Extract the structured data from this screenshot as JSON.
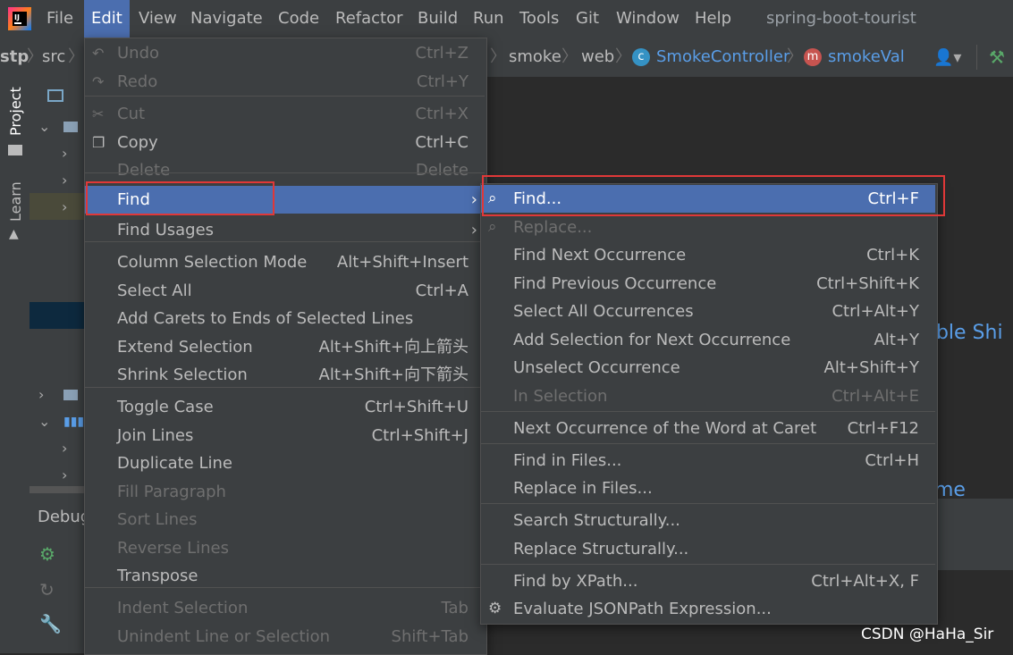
{
  "menubar": {
    "items": [
      "File",
      "Edit",
      "View",
      "Navigate",
      "Code",
      "Refactor",
      "Build",
      "Run",
      "Tools",
      "Git",
      "Window",
      "Help"
    ],
    "active": "Edit",
    "project_name": "spring-boot-tourist"
  },
  "navbar": {
    "crumbs": [
      "stp",
      "src",
      "smoke",
      "web",
      "SmokeController",
      "smokeVal"
    ],
    "class_badge": "c",
    "method_badge": "m"
  },
  "sidebar": {
    "project_tab": "Project",
    "learn_tab": "Learn",
    "debug_label": "Debug"
  },
  "edit_menu": {
    "items": [
      {
        "label": "Undo",
        "shortcut": "Ctrl+Z",
        "disabled": true
      },
      {
        "label": "Redo",
        "shortcut": "Ctrl+Y",
        "disabled": true
      },
      {
        "label": "Cut",
        "shortcut": "Ctrl+X",
        "disabled": true
      },
      {
        "label": "Copy",
        "shortcut": "Ctrl+C",
        "disabled": false
      },
      {
        "label": "Delete",
        "shortcut": "Delete",
        "disabled": true
      },
      {
        "label": "Find",
        "shortcut": "",
        "disabled": false,
        "submenu": true,
        "selected": true
      },
      {
        "label": "Find Usages",
        "shortcut": "",
        "disabled": false,
        "submenu": true
      },
      {
        "label": "Column Selection Mode",
        "shortcut": "Alt+Shift+Insert",
        "disabled": false
      },
      {
        "label": "Select All",
        "shortcut": "Ctrl+A",
        "disabled": false
      },
      {
        "label": "Add Carets to Ends of Selected Lines",
        "shortcut": "",
        "disabled": false
      },
      {
        "label": "Extend Selection",
        "shortcut": "Alt+Shift+向上箭头",
        "disabled": false
      },
      {
        "label": "Shrink Selection",
        "shortcut": "Alt+Shift+向下箭头",
        "disabled": false
      },
      {
        "label": "Toggle Case",
        "shortcut": "Ctrl+Shift+U",
        "disabled": false
      },
      {
        "label": "Join Lines",
        "shortcut": "Ctrl+Shift+J",
        "disabled": false
      },
      {
        "label": "Duplicate Line",
        "shortcut": "",
        "disabled": false
      },
      {
        "label": "Fill Paragraph",
        "shortcut": "",
        "disabled": true
      },
      {
        "label": "Sort Lines",
        "shortcut": "",
        "disabled": true
      },
      {
        "label": "Reverse Lines",
        "shortcut": "",
        "disabled": true
      },
      {
        "label": "Transpose",
        "shortcut": "",
        "disabled": false
      },
      {
        "label": "Indent Selection",
        "shortcut": "Tab",
        "disabled": true
      },
      {
        "label": "Unindent Line or Selection",
        "shortcut": "Shift+Tab",
        "disabled": true
      }
    ]
  },
  "find_submenu": {
    "items": [
      {
        "label": "Find...",
        "shortcut": "Ctrl+F",
        "disabled": false,
        "selected": true
      },
      {
        "label": "Replace...",
        "shortcut": "",
        "disabled": true
      },
      {
        "label": "Find Next Occurrence",
        "shortcut": "Ctrl+K",
        "disabled": false
      },
      {
        "label": "Find Previous Occurrence",
        "shortcut": "Ctrl+Shift+K",
        "disabled": false
      },
      {
        "label": "Select All Occurrences",
        "shortcut": "Ctrl+Alt+Y",
        "disabled": false
      },
      {
        "label": "Add Selection for Next Occurrence",
        "shortcut": "Alt+Y",
        "disabled": false
      },
      {
        "label": "Unselect Occurrence",
        "shortcut": "Alt+Shift+Y",
        "disabled": false
      },
      {
        "label": "In Selection",
        "shortcut": "Ctrl+Alt+E",
        "disabled": true
      },
      {
        "label": "Next Occurrence of the Word at Caret",
        "shortcut": "Ctrl+F12",
        "disabled": false
      },
      {
        "label": "Find in Files...",
        "shortcut": "Ctrl+H",
        "disabled": false
      },
      {
        "label": "Replace in Files...",
        "shortcut": "",
        "disabled": false
      },
      {
        "label": "Search Structurally...",
        "shortcut": "",
        "disabled": false
      },
      {
        "label": "Replace Structurally...",
        "shortcut": "",
        "disabled": false
      },
      {
        "label": "Find by XPath...",
        "shortcut": "Ctrl+Alt+X, F",
        "disabled": false
      },
      {
        "label": "Evaluate JSONPath Expression...",
        "shortcut": "",
        "disabled": false
      }
    ]
  },
  "editor_hints": {
    "hint1": "uble Shi",
    "hint2": "me"
  },
  "watermark": "CSDN @HaHa_Sir",
  "colors": {
    "accent": "#4b6eaf",
    "highlight_box": "#e03838",
    "link": "#5a9ee8"
  }
}
